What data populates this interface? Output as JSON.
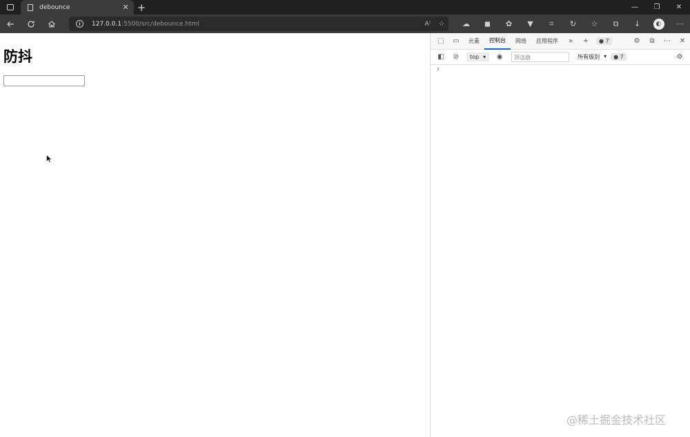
{
  "tab": {
    "title": "debounce",
    "close": "✕",
    "new_tab": "+"
  },
  "window_controls": {
    "minimize": "—",
    "restore": "❐",
    "close": "✕"
  },
  "address": {
    "host": "127.0.0.1",
    "rest": ":5500/src/debounce.html",
    "read_aloud": "A⁾"
  },
  "page": {
    "heading": "防抖",
    "input_value": ""
  },
  "devtools": {
    "tabs": [
      "元素",
      "控制台",
      "网络",
      "应用程序"
    ],
    "active_tab": "控制台",
    "more": "»",
    "add": "+",
    "issues_count": "7",
    "context": "top",
    "filter_placeholder": "筛选器",
    "levels": "所有级别",
    "messages_count": "7",
    "prompt": "›"
  },
  "watermark": "@稀土掘金技术社区"
}
